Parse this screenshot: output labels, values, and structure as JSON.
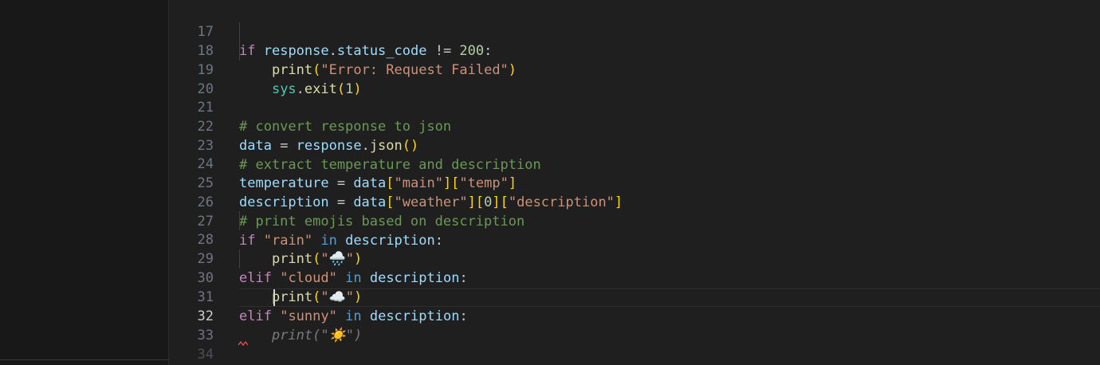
{
  "editor": {
    "active_line": "32",
    "lines": [
      {
        "n": "17",
        "t": [
          "if",
          " ",
          "response",
          ".",
          "status_code",
          " != ",
          "200",
          ":"
        ]
      },
      {
        "n": "18",
        "t": [
          "    ",
          "print",
          "(",
          "\"Error: Request Failed\"",
          ")"
        ]
      },
      {
        "n": "19",
        "t": [
          "    ",
          "sys",
          ".",
          "exit",
          "(",
          "1",
          ")"
        ]
      },
      {
        "n": "20",
        "t": []
      },
      {
        "n": "21",
        "t": [
          "# convert response to json"
        ]
      },
      {
        "n": "22",
        "t": [
          "data",
          " = ",
          "response",
          ".",
          "json",
          "()"
        ]
      },
      {
        "n": "23",
        "t": [
          "# extract temperature and description"
        ]
      },
      {
        "n": "24",
        "t": [
          "temperature",
          " = ",
          "data",
          "[",
          "\"main\"",
          "][",
          "\"temp\"",
          "]"
        ]
      },
      {
        "n": "25",
        "t": [
          "description",
          " = ",
          "data",
          "[",
          "\"weather\"",
          "][",
          "0",
          "][",
          "\"description\"",
          "]"
        ]
      },
      {
        "n": "26",
        "t": [
          "# print emojis based on description"
        ]
      },
      {
        "n": "27",
        "t": [
          "if",
          " ",
          "\"rain\"",
          " ",
          "in",
          " ",
          "description",
          ":"
        ]
      },
      {
        "n": "28",
        "t": [
          "    ",
          "print",
          "(",
          "\"🌧️\"",
          ")"
        ]
      },
      {
        "n": "29",
        "t": [
          "elif",
          " ",
          "\"cloud\"",
          " ",
          "in",
          " ",
          "description",
          ":"
        ]
      },
      {
        "n": "30",
        "t": [
          "    ",
          "print",
          "(",
          "\"☁️\"",
          ")"
        ]
      },
      {
        "n": "31",
        "t": [
          "elif",
          " ",
          "\"sunny\"",
          " ",
          "in",
          " ",
          "description",
          ":"
        ]
      },
      {
        "n": "32",
        "t": [
          "    ",
          "print(\"☀️\")"
        ]
      },
      {
        "n": "33",
        "t": []
      },
      {
        "n": "34",
        "t": []
      }
    ]
  },
  "colors": {
    "keyword": "#c586c0",
    "variable": "#9cdcfe",
    "function": "#dcdcaa",
    "string": "#ce9178",
    "comment": "#6a9955",
    "error_squiggle": "#f14c4c"
  }
}
